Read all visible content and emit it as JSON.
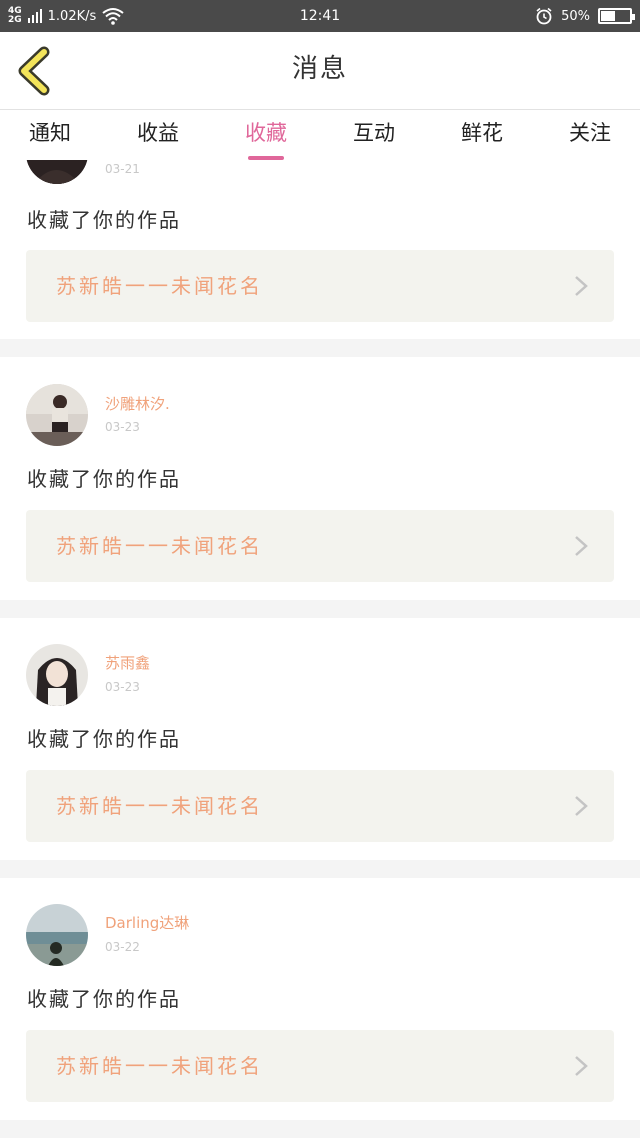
{
  "status_bar": {
    "network_top": "4G",
    "network_bottom": "2G",
    "speed": "1.02K/s",
    "time": "12:41",
    "battery": "50%",
    "battery_level": 0.5
  },
  "header": {
    "title": "消息"
  },
  "tabs": [
    {
      "label": "通知"
    },
    {
      "label": "收益"
    },
    {
      "label": "收藏"
    },
    {
      "label": "互动"
    },
    {
      "label": "鲜花"
    },
    {
      "label": "关注"
    }
  ],
  "active_tab": "收藏",
  "colors": {
    "accent_pink": "#e0679a",
    "name_orange": "#f0a27b",
    "back_yellow": "#f3e45a"
  },
  "feed": [
    {
      "name": "",
      "date": "03-21",
      "message": "收藏了你的作品",
      "work_title": "苏新皓一一未闻花名",
      "avatar_icon": "avatar-dark-icon"
    },
    {
      "name": "沙雕林汐.",
      "date": "03-23",
      "message": "收藏了你的作品",
      "work_title": "苏新皓一一未闻花名",
      "avatar_icon": "avatar-girl-back-icon"
    },
    {
      "name": "苏雨鑫",
      "date": "03-23",
      "message": "收藏了你的作品",
      "work_title": "苏新皓一一未闻花名",
      "avatar_icon": "avatar-girl-portrait-icon"
    },
    {
      "name": "Darling达琳",
      "date": "03-22",
      "message": "收藏了你的作品",
      "work_title": "苏新皓一一未闻花名",
      "avatar_icon": "avatar-beach-icon"
    }
  ]
}
